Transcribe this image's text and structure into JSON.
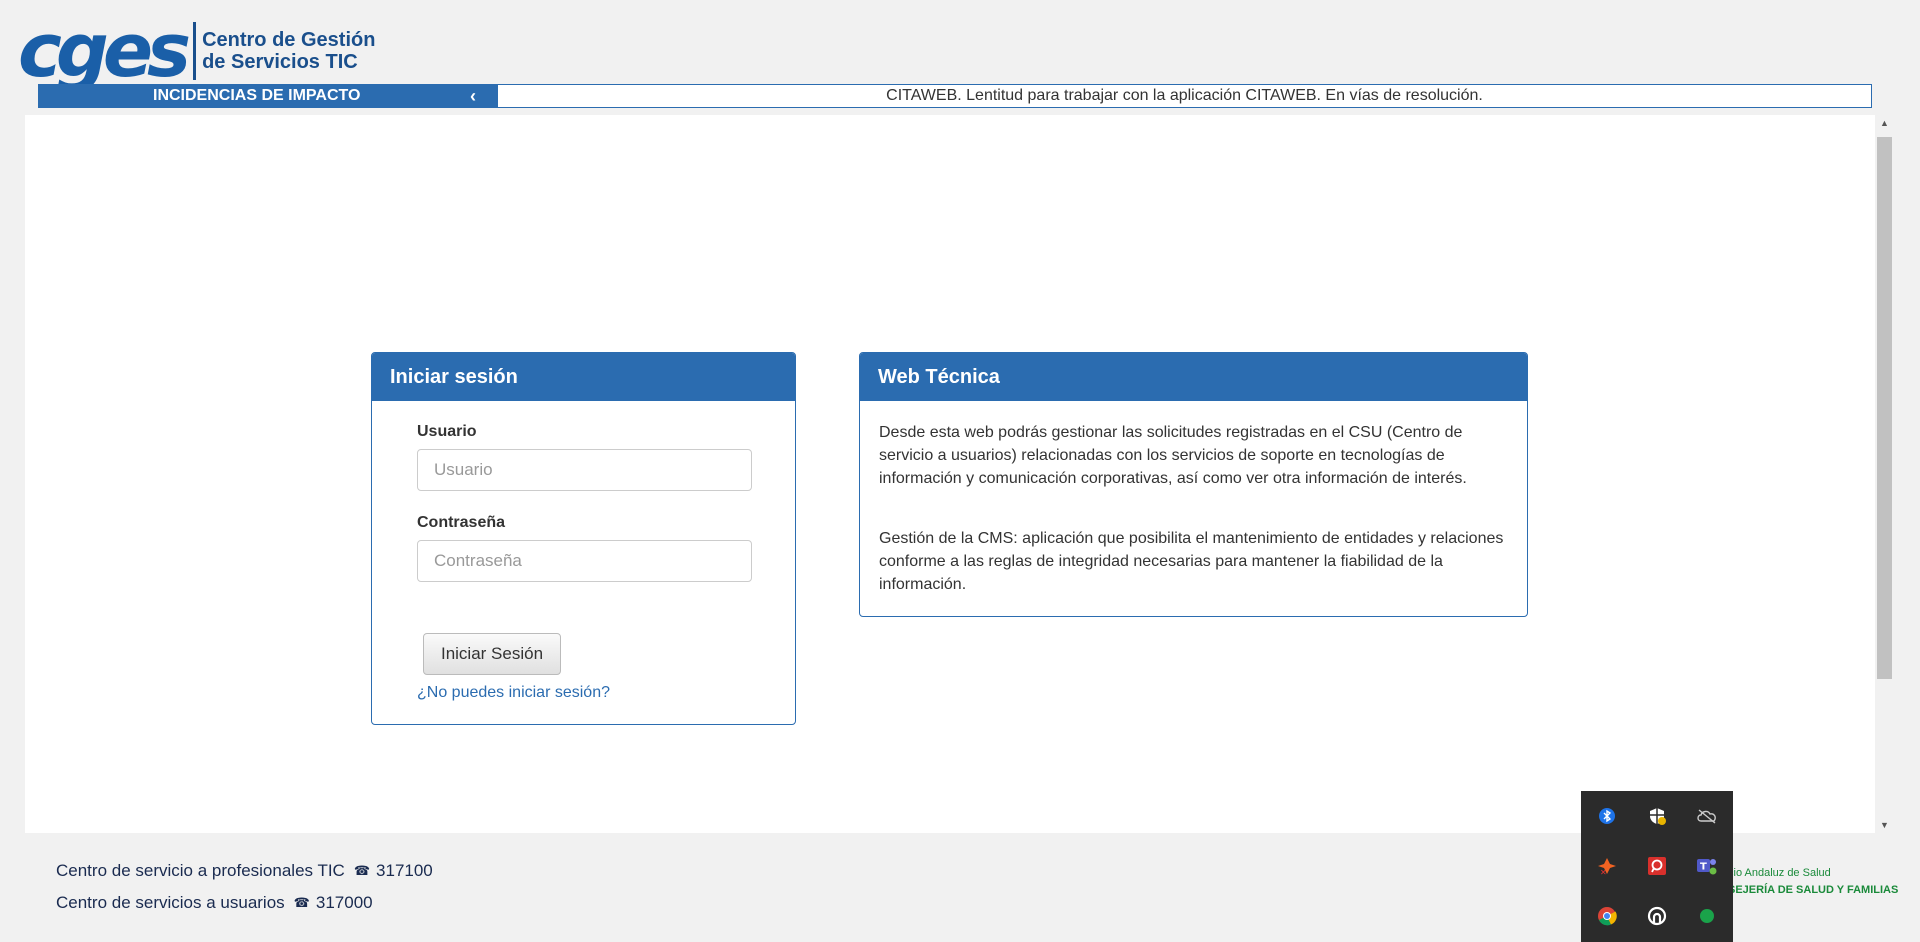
{
  "logo": {
    "mark": "cges",
    "line1": "Centro de Gestión",
    "line2": "de Servicios TIC"
  },
  "ticker": {
    "title": "INCIDENCIAS DE IMPACTO",
    "arrow": "‹",
    "message": "CITAWEB. Lentitud para trabajar con la aplicación CITAWEB. En vías de resolución."
  },
  "login": {
    "title": "Iniciar sesión",
    "user_label": "Usuario",
    "user_placeholder": "Usuario",
    "pass_label": "Contraseña",
    "pass_placeholder": "Contraseña",
    "submit_label": "Iniciar Sesión",
    "help_link": "¿No puedes iniciar sesión?"
  },
  "web": {
    "title": "Web Técnica",
    "para1": "Desde esta web podrás gestionar las solicitudes registradas en el CSU (Centro de servicio a usuarios) relacionadas con los servicios de soporte en tecnologías de información y comunicación corporativas, así como ver otra información de interés.",
    "para2": "Gestión de la CMS: aplicación que posibilita el mantenimiento de entidades y relaciones conforme a las reglas de integridad necesarias para mantener la fiabilidad de la información."
  },
  "footer": {
    "line1_text": "Centro de servicio a profesionales TIC",
    "line1_phone": "317100",
    "line2_text": "Centro de servicios a usuarios",
    "line2_phone": "317000",
    "phone_icon": "☎"
  },
  "brand": {
    "line1": "cio Andaluz de Salud",
    "line2": "SEJERÍA DE SALUD Y FAMILIAS"
  },
  "tray": {
    "icons": [
      "bluetooth-icon",
      "security-shield-icon",
      "cloud-offline-icon",
      "fortinet-icon",
      "remote-support-icon",
      "teams-icon",
      "chrome-icon",
      "sync-app-icon",
      "status-dot-icon"
    ]
  },
  "colors": {
    "primary": "#2b6cb0",
    "link": "#2b6cb0",
    "brand_green": "#1a8a3a"
  }
}
